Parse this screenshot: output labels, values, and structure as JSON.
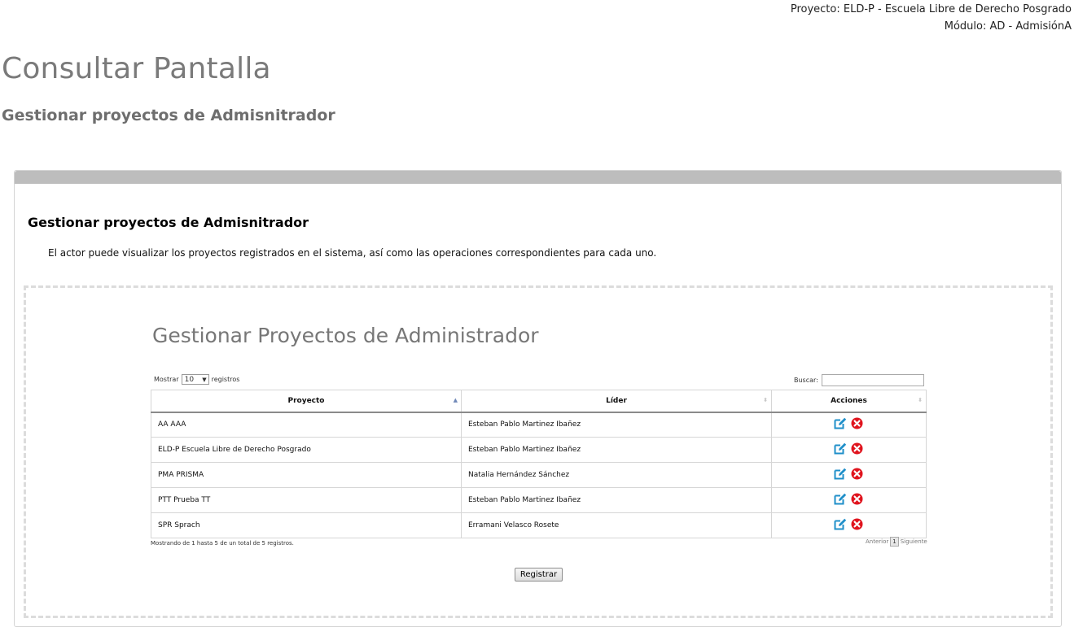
{
  "header": {
    "project_line": "Proyecto: ELD-P - Escuela Libre de Derecho Posgrado",
    "module_line": "Módulo: AD - AdmisiónA"
  },
  "page": {
    "title": "Consultar Pantalla",
    "subtitle": "Gestionar proyectos de Admisnitrador"
  },
  "section": {
    "title": "Gestionar proyectos de Admisnitrador",
    "description": "El actor puede visualizar los proyectos registrados en el sistema, así como las operaciones correspondientes para cada uno."
  },
  "screen": {
    "title": "Gestionar Proyectos de Administrador",
    "length_prefix": "Mostrar",
    "length_value": "10",
    "length_suffix": "registros",
    "search_label": "Buscar:",
    "search_value": "",
    "columns": [
      "Proyecto",
      "Líder",
      "Acciones"
    ],
    "rows": [
      {
        "proyecto": "AA AAA",
        "lider": "Esteban Pablo Martinez Ibañez"
      },
      {
        "proyecto": "ELD-P Escuela Libre de Derecho Posgrado",
        "lider": "Esteban Pablo Martinez Ibañez"
      },
      {
        "proyecto": "PMA PRISMA",
        "lider": "Natalia Hernández Sánchez"
      },
      {
        "proyecto": "PTT Prueba TT",
        "lider": "Esteban Pablo Martinez Ibañez"
      },
      {
        "proyecto": "SPR Sprach",
        "lider": "Erramani Velasco Rosete"
      }
    ],
    "info": "Mostrando de 1 hasta 5 de un total de 5 registros.",
    "pagination": {
      "previous": "Anterior",
      "current": "1",
      "next": "Siguiente"
    },
    "register_button": "Registrar"
  },
  "colors": {
    "edit_icon": "#1f8fc9",
    "delete_icon": "#e0141e",
    "panel_header": "#bdbdbd",
    "title_gray": "#7a7a7a"
  }
}
